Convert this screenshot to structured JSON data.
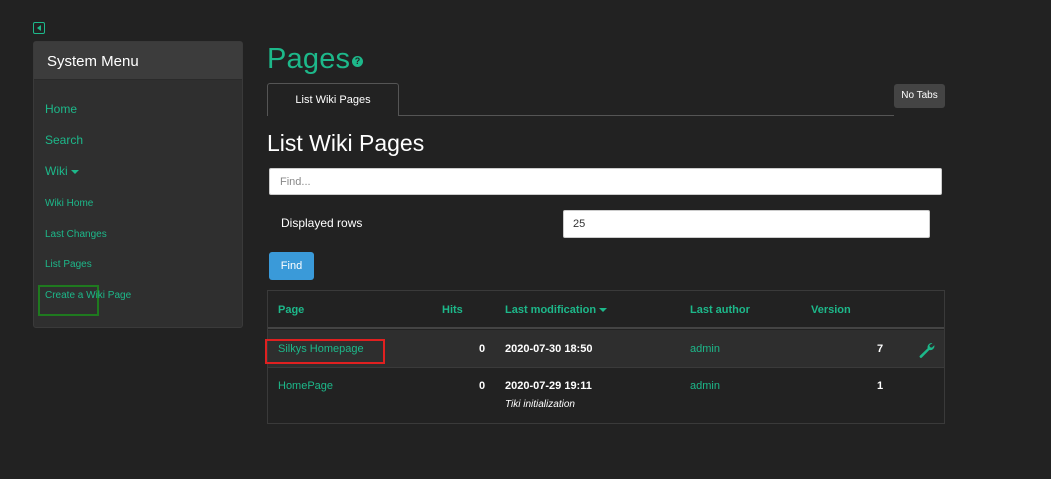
{
  "sidebar": {
    "title": "System Menu",
    "items": [
      {
        "label": "Home"
      },
      {
        "label": "Search"
      },
      {
        "label": "Wiki"
      },
      {
        "label": "Wiki Home"
      },
      {
        "label": "Last Changes"
      },
      {
        "label": "List Pages"
      },
      {
        "label": "Create a Wiki Page"
      }
    ]
  },
  "main": {
    "title": "Pages",
    "help_icon": "?",
    "tab_label": "List Wiki Pages",
    "no_tabs_label": "No Tabs",
    "section_title": "List Wiki Pages",
    "find_placeholder": "Find...",
    "rows_label": "Displayed rows",
    "rows_value": "25",
    "find_button": "Find"
  },
  "table": {
    "headers": {
      "page": "Page",
      "hits": "Hits",
      "last_modification": "Last modification",
      "last_author": "Last author",
      "version": "Version"
    },
    "rows": [
      {
        "page": "Silkys Homepage",
        "hits": "0",
        "modified": "2020-07-30 18:50",
        "comment": "",
        "author": "admin",
        "version": "7",
        "action_icon": "wrench-icon"
      },
      {
        "page": "HomePage",
        "hits": "0",
        "modified": "2020-07-29 19:11",
        "comment": "Tiki initialization",
        "author": "admin",
        "version": "1",
        "action_icon": ""
      }
    ]
  },
  "colors": {
    "accent": "#1db88a",
    "background": "#222222",
    "button": "#3a9ad9",
    "highlight": "#e02020"
  }
}
